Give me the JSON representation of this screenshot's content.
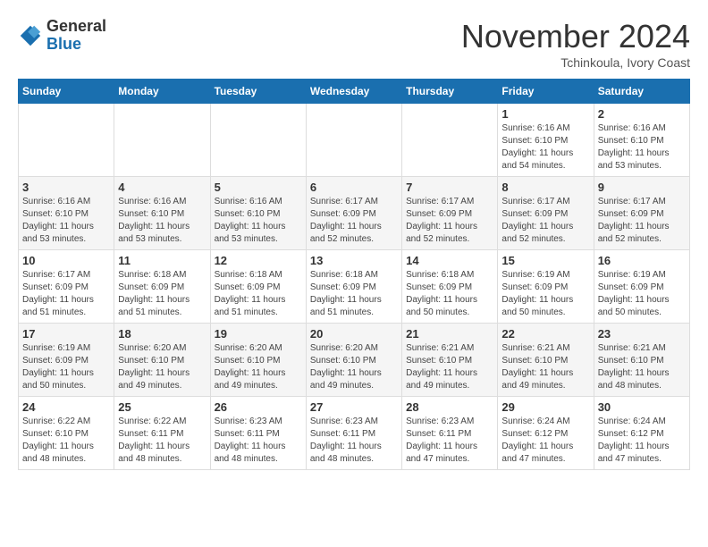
{
  "header": {
    "logo_line1": "General",
    "logo_line2": "Blue",
    "month": "November 2024",
    "location": "Tchinkoula, Ivory Coast"
  },
  "weekdays": [
    "Sunday",
    "Monday",
    "Tuesday",
    "Wednesday",
    "Thursday",
    "Friday",
    "Saturday"
  ],
  "weeks": [
    [
      {
        "day": "",
        "info": ""
      },
      {
        "day": "",
        "info": ""
      },
      {
        "day": "",
        "info": ""
      },
      {
        "day": "",
        "info": ""
      },
      {
        "day": "",
        "info": ""
      },
      {
        "day": "1",
        "info": "Sunrise: 6:16 AM\nSunset: 6:10 PM\nDaylight: 11 hours\nand 54 minutes."
      },
      {
        "day": "2",
        "info": "Sunrise: 6:16 AM\nSunset: 6:10 PM\nDaylight: 11 hours\nand 53 minutes."
      }
    ],
    [
      {
        "day": "3",
        "info": "Sunrise: 6:16 AM\nSunset: 6:10 PM\nDaylight: 11 hours\nand 53 minutes."
      },
      {
        "day": "4",
        "info": "Sunrise: 6:16 AM\nSunset: 6:10 PM\nDaylight: 11 hours\nand 53 minutes."
      },
      {
        "day": "5",
        "info": "Sunrise: 6:16 AM\nSunset: 6:10 PM\nDaylight: 11 hours\nand 53 minutes."
      },
      {
        "day": "6",
        "info": "Sunrise: 6:17 AM\nSunset: 6:09 PM\nDaylight: 11 hours\nand 52 minutes."
      },
      {
        "day": "7",
        "info": "Sunrise: 6:17 AM\nSunset: 6:09 PM\nDaylight: 11 hours\nand 52 minutes."
      },
      {
        "day": "8",
        "info": "Sunrise: 6:17 AM\nSunset: 6:09 PM\nDaylight: 11 hours\nand 52 minutes."
      },
      {
        "day": "9",
        "info": "Sunrise: 6:17 AM\nSunset: 6:09 PM\nDaylight: 11 hours\nand 52 minutes."
      }
    ],
    [
      {
        "day": "10",
        "info": "Sunrise: 6:17 AM\nSunset: 6:09 PM\nDaylight: 11 hours\nand 51 minutes."
      },
      {
        "day": "11",
        "info": "Sunrise: 6:18 AM\nSunset: 6:09 PM\nDaylight: 11 hours\nand 51 minutes."
      },
      {
        "day": "12",
        "info": "Sunrise: 6:18 AM\nSunset: 6:09 PM\nDaylight: 11 hours\nand 51 minutes."
      },
      {
        "day": "13",
        "info": "Sunrise: 6:18 AM\nSunset: 6:09 PM\nDaylight: 11 hours\nand 51 minutes."
      },
      {
        "day": "14",
        "info": "Sunrise: 6:18 AM\nSunset: 6:09 PM\nDaylight: 11 hours\nand 50 minutes."
      },
      {
        "day": "15",
        "info": "Sunrise: 6:19 AM\nSunset: 6:09 PM\nDaylight: 11 hours\nand 50 minutes."
      },
      {
        "day": "16",
        "info": "Sunrise: 6:19 AM\nSunset: 6:09 PM\nDaylight: 11 hours\nand 50 minutes."
      }
    ],
    [
      {
        "day": "17",
        "info": "Sunrise: 6:19 AM\nSunset: 6:09 PM\nDaylight: 11 hours\nand 50 minutes."
      },
      {
        "day": "18",
        "info": "Sunrise: 6:20 AM\nSunset: 6:10 PM\nDaylight: 11 hours\nand 49 minutes."
      },
      {
        "day": "19",
        "info": "Sunrise: 6:20 AM\nSunset: 6:10 PM\nDaylight: 11 hours\nand 49 minutes."
      },
      {
        "day": "20",
        "info": "Sunrise: 6:20 AM\nSunset: 6:10 PM\nDaylight: 11 hours\nand 49 minutes."
      },
      {
        "day": "21",
        "info": "Sunrise: 6:21 AM\nSunset: 6:10 PM\nDaylight: 11 hours\nand 49 minutes."
      },
      {
        "day": "22",
        "info": "Sunrise: 6:21 AM\nSunset: 6:10 PM\nDaylight: 11 hours\nand 49 minutes."
      },
      {
        "day": "23",
        "info": "Sunrise: 6:21 AM\nSunset: 6:10 PM\nDaylight: 11 hours\nand 48 minutes."
      }
    ],
    [
      {
        "day": "24",
        "info": "Sunrise: 6:22 AM\nSunset: 6:10 PM\nDaylight: 11 hours\nand 48 minutes."
      },
      {
        "day": "25",
        "info": "Sunrise: 6:22 AM\nSunset: 6:11 PM\nDaylight: 11 hours\nand 48 minutes."
      },
      {
        "day": "26",
        "info": "Sunrise: 6:23 AM\nSunset: 6:11 PM\nDaylight: 11 hours\nand 48 minutes."
      },
      {
        "day": "27",
        "info": "Sunrise: 6:23 AM\nSunset: 6:11 PM\nDaylight: 11 hours\nand 48 minutes."
      },
      {
        "day": "28",
        "info": "Sunrise: 6:23 AM\nSunset: 6:11 PM\nDaylight: 11 hours\nand 47 minutes."
      },
      {
        "day": "29",
        "info": "Sunrise: 6:24 AM\nSunset: 6:12 PM\nDaylight: 11 hours\nand 47 minutes."
      },
      {
        "day": "30",
        "info": "Sunrise: 6:24 AM\nSunset: 6:12 PM\nDaylight: 11 hours\nand 47 minutes."
      }
    ]
  ]
}
